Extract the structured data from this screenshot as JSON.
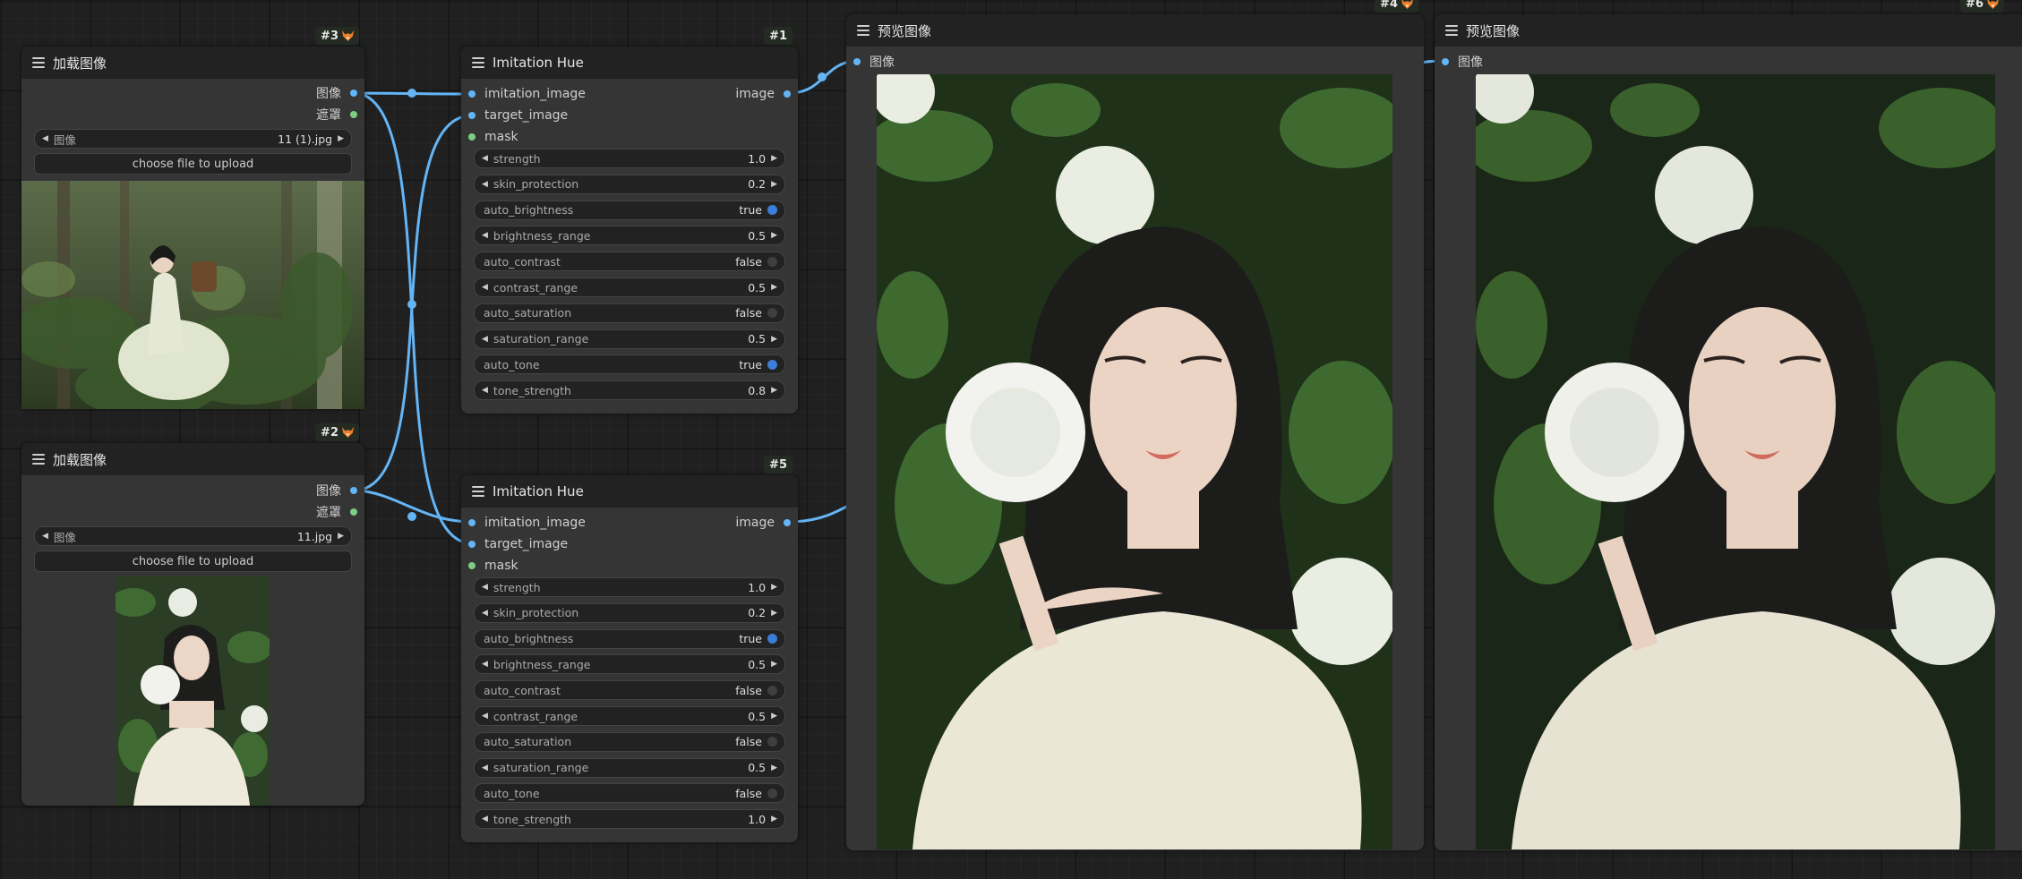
{
  "colors": {
    "canvas": "#202020",
    "node_body": "#353535",
    "node_header": "#222222",
    "wire": "#64b5f6",
    "slot_image": "#64b5f6",
    "slot_mask": "#7ccf82",
    "toggle_on": "#3b7ed9"
  },
  "nodes": {
    "load1": {
      "id": "#3",
      "title": "加载图像",
      "outputs": [
        "图像",
        "遮罩"
      ],
      "image_widget": {
        "label": "图像",
        "value": "11 (1).jpg"
      },
      "upload_label": "choose file to upload"
    },
    "load2": {
      "id": "#2",
      "title": "加载图像",
      "outputs": [
        "图像",
        "遮罩"
      ],
      "image_widget": {
        "label": "图像",
        "value": "11.jpg"
      },
      "upload_label": "choose file to upload"
    },
    "hue1": {
      "id": "#1",
      "title": "Imitation Hue",
      "inputs": [
        "imitation_image",
        "target_image",
        "mask"
      ],
      "output": "image",
      "widgets": [
        {
          "label": "strength",
          "value": "1.0",
          "type": "number"
        },
        {
          "label": "skin_protection",
          "value": "0.2",
          "type": "number"
        },
        {
          "label": "auto_brightness",
          "value": "true",
          "type": "toggle",
          "on": true
        },
        {
          "label": "brightness_range",
          "value": "0.5",
          "type": "number"
        },
        {
          "label": "auto_contrast",
          "value": "false",
          "type": "toggle",
          "on": false
        },
        {
          "label": "contrast_range",
          "value": "0.5",
          "type": "number"
        },
        {
          "label": "auto_saturation",
          "value": "false",
          "type": "toggle",
          "on": false
        },
        {
          "label": "saturation_range",
          "value": "0.5",
          "type": "number"
        },
        {
          "label": "auto_tone",
          "value": "true",
          "type": "toggle",
          "on": true
        },
        {
          "label": "tone_strength",
          "value": "0.8",
          "type": "number"
        }
      ]
    },
    "hue2": {
      "id": "#5",
      "title": "Imitation Hue",
      "inputs": [
        "imitation_image",
        "target_image",
        "mask"
      ],
      "output": "image",
      "widgets": [
        {
          "label": "strength",
          "value": "1.0",
          "type": "number"
        },
        {
          "label": "skin_protection",
          "value": "0.2",
          "type": "number"
        },
        {
          "label": "auto_brightness",
          "value": "true",
          "type": "toggle",
          "on": true
        },
        {
          "label": "brightness_range",
          "value": "0.5",
          "type": "number"
        },
        {
          "label": "auto_contrast",
          "value": "false",
          "type": "toggle",
          "on": false
        },
        {
          "label": "contrast_range",
          "value": "0.5",
          "type": "number"
        },
        {
          "label": "auto_saturation",
          "value": "false",
          "type": "toggle",
          "on": false
        },
        {
          "label": "saturation_range",
          "value": "0.5",
          "type": "number"
        },
        {
          "label": "auto_tone",
          "value": "false",
          "type": "toggle",
          "on": false
        },
        {
          "label": "tone_strength",
          "value": "1.0",
          "type": "number"
        }
      ]
    },
    "preview1": {
      "id": "#4",
      "title": "预览图像",
      "input": "图像"
    },
    "preview2": {
      "id": "#6",
      "title": "预览图像",
      "input": "图像"
    }
  }
}
